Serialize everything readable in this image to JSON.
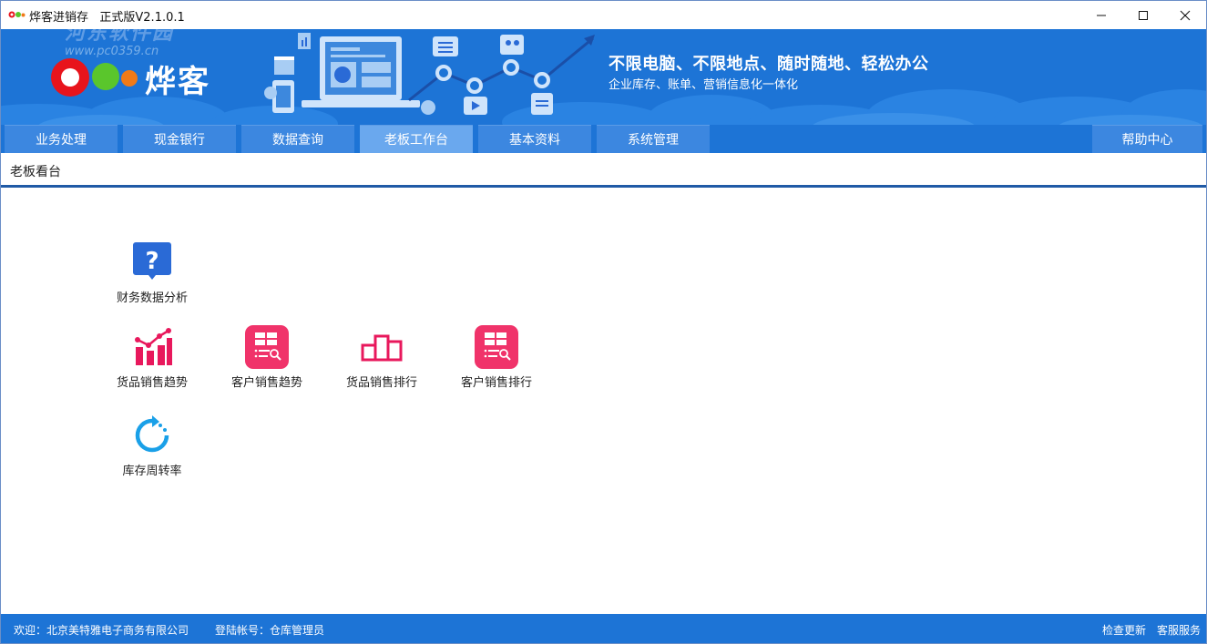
{
  "window": {
    "title": "烨客进销存   正式版V2.1.0.1"
  },
  "banner": {
    "brand": "烨客",
    "slogan_main": "不限电脑、不限地点、随时随地、轻松办公",
    "slogan_sub": "企业库存、账单、营销信息化一体化",
    "watermark": "河东软件园",
    "watermark_url": "www.pc0359.cn"
  },
  "nav": {
    "tabs": [
      {
        "label": "业务处理"
      },
      {
        "label": "现金银行"
      },
      {
        "label": "数据查询"
      },
      {
        "label": "老板工作台",
        "active": true
      },
      {
        "label": "基本资料"
      },
      {
        "label": "系统管理"
      }
    ],
    "help": "帮助中心"
  },
  "page": {
    "title": "老板看台"
  },
  "tiles": [
    {
      "label": "财务数据分析",
      "icon": "question-icon"
    },
    {
      "label": "货品销售趋势",
      "icon": "bar-trend-icon"
    },
    {
      "label": "客户销售趋势",
      "icon": "customer-table-icon"
    },
    {
      "label": "货品销售排行",
      "icon": "ranking-podium-icon"
    },
    {
      "label": "客户销售排行",
      "icon": "customer-table-icon"
    },
    {
      "label": "库存周转率",
      "icon": "refresh-icon"
    }
  ],
  "status": {
    "welcome": "欢迎：北京美特雅电子商务有限公司",
    "account": "登陆帐号：仓库管理员",
    "check_update": "检查更新",
    "customer_service": "客服服务"
  },
  "colors": {
    "banner_blue": "#1d74d6",
    "tab_blue": "#3c87e0",
    "tab_active": "#6aa8ee",
    "tile_red": "#e8185c",
    "tile_blue": "#2a6ad6",
    "refresh_blue": "#1aa0e8"
  }
}
